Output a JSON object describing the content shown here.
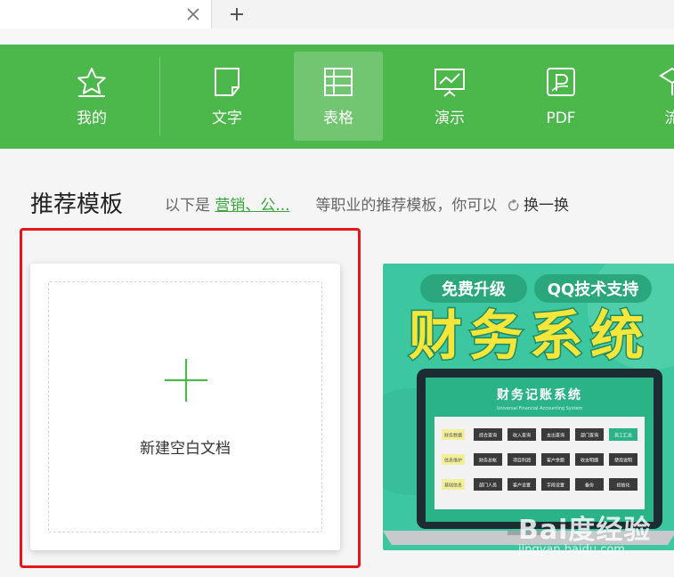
{
  "tabbar": {
    "close_icon": "close-icon",
    "new_tab_icon": "plus-icon"
  },
  "toolbar": {
    "items": [
      {
        "label": "我的",
        "icon": "star-icon"
      },
      {
        "label": "文字",
        "icon": "document-icon"
      },
      {
        "label": "表格",
        "icon": "spreadsheet-icon",
        "active": true
      },
      {
        "label": "演示",
        "icon": "presentation-icon"
      },
      {
        "label": "PDF",
        "icon": "pdf-icon"
      },
      {
        "label": "流",
        "icon": "flowchart-icon"
      }
    ],
    "colors": {
      "bg": "#4cb74a",
      "active": "rgba(255,255,255,0.22)"
    }
  },
  "section": {
    "title": "推荐模板",
    "sub_prefix": "以下是",
    "sub_link": "营销、公...",
    "sub_suffix": "等职业的推荐模板，你可以",
    "refresh_label": "换一换"
  },
  "new_card": {
    "label": "新建空白文档"
  },
  "template_card": {
    "badge_left": "免费升级",
    "badge_right": "QQ技术支持",
    "big_title": "财务系统",
    "screen_title": "财务记账系统",
    "screen_subtitle": "Universal Financial Accounting System",
    "rows": [
      {
        "tag": "财务数据",
        "buttons": [
          "综合查询",
          "收入查询",
          "支出查询",
          "部门查询",
          "员工汇总"
        ]
      },
      {
        "tag": "信息维护",
        "buttons": [
          "财务总帐",
          "项目利润",
          "客户余额",
          "收支明细",
          "使用说明"
        ]
      },
      {
        "tag": "基础信息",
        "buttons": [
          "部门人员",
          "客户设置",
          "字段设置",
          "备份",
          "初始化"
        ]
      }
    ],
    "colors": {
      "bg": "#3cc7a0",
      "title": "#f7e63a",
      "title_outline": "#1f8a64",
      "badge": "#2aa77d",
      "laptop": "#1d2c33",
      "screen": "#2bb388"
    }
  },
  "watermark": {
    "brand": "Bai度经验",
    "url": "jingyan.baidu.com"
  },
  "highlight": {
    "color": "#e5161c"
  }
}
